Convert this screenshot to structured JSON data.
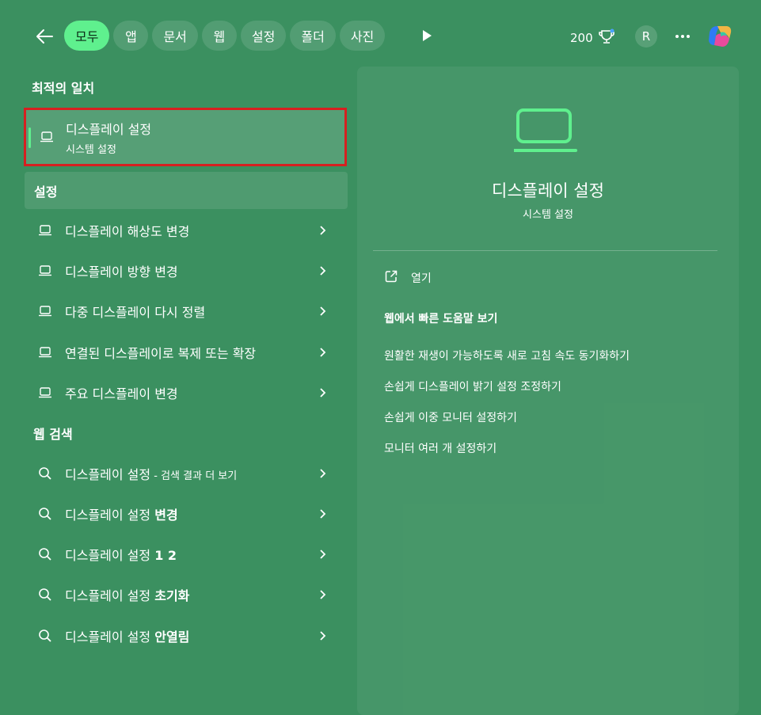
{
  "tabs": [
    "모두",
    "앱",
    "문서",
    "웹",
    "설정",
    "폴더",
    "사진"
  ],
  "header": {
    "points": "200",
    "avatar_initial": "R"
  },
  "best_match": {
    "title": "최적의 일치",
    "item": {
      "title": "디스플레이 설정",
      "subtitle": "시스템 설정",
      "icon": "laptop-icon"
    }
  },
  "settings": {
    "title": "설정",
    "items": [
      "디스플레이 해상도 변경",
      "디스플레이 방향 변경",
      "다중 디스플레이 다시 정렬",
      "연결된 디스플레이로 복제 또는 확장",
      "주요 디스플레이 변경"
    ]
  },
  "web_search": {
    "title": "웹 검색",
    "items": [
      {
        "main": "디스플레이 설정",
        "suffix": " - 검색 결과 더 보기",
        "bold": ""
      },
      {
        "main": "디스플레이 설정 ",
        "suffix": "",
        "bold": "변경"
      },
      {
        "main": "디스플레이 설정 ",
        "suffix": "",
        "bold": "1 2"
      },
      {
        "main": "디스플레이 설정 ",
        "suffix": "",
        "bold": "초기화"
      },
      {
        "main": "디스플레이 설정 ",
        "suffix": "",
        "bold": "안열림"
      }
    ]
  },
  "detail": {
    "title": "디스플레이 설정",
    "subtitle": "시스템 설정",
    "open_label": "열기",
    "help_title": "웹에서 빠른 도움말 보기",
    "help_links": [
      "원활한 재생이 가능하도록 새로 고침 속도 동기화하기",
      "손쉽게 디스플레이 밝기 설정 조정하기",
      "손쉽게 이중 모니터 설정하기",
      "모니터 여러 개 설정하기"
    ]
  },
  "colors": {
    "accent": "#5ff08e",
    "background": "#3b9060",
    "highlight_border": "#d62020"
  }
}
